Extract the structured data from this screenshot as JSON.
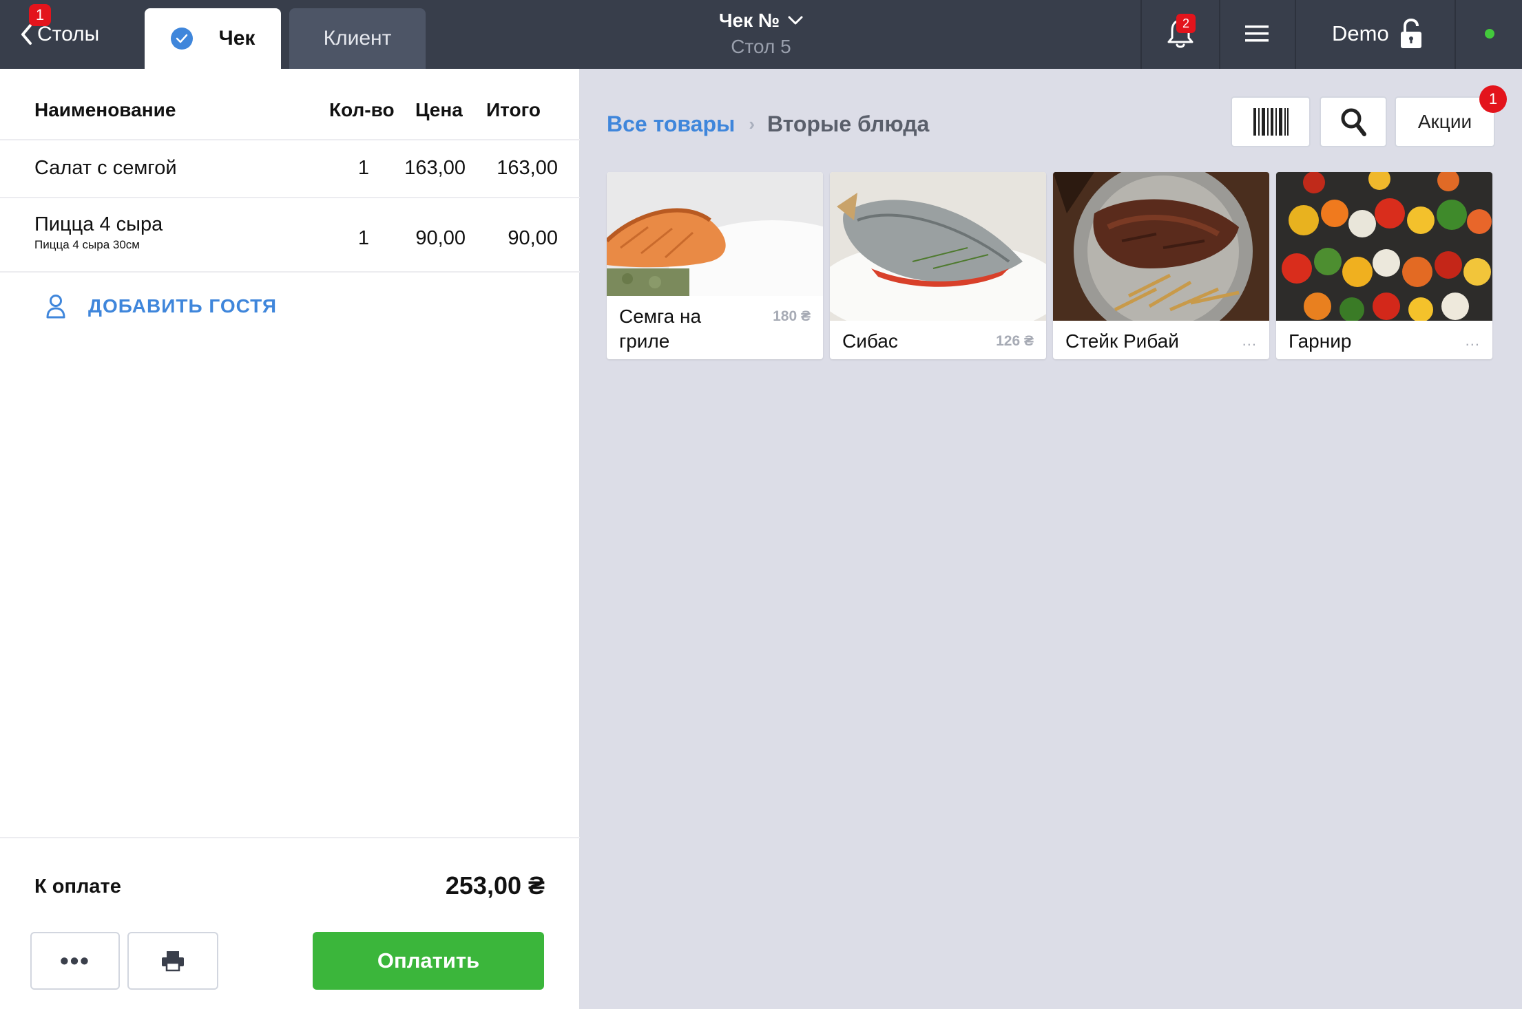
{
  "topbar": {
    "back_label": "Столы",
    "back_badge": "1",
    "tabs": [
      {
        "label": "Чек",
        "active": true
      },
      {
        "label": "Клиент",
        "active": false
      }
    ],
    "order_title": "Чек №",
    "table_label": "Стол 5",
    "notifications_badge": "2",
    "user_name": "Demo",
    "status_color": "#43c93c"
  },
  "order": {
    "columns": {
      "name": "Наименование",
      "qty": "Кол-во",
      "price": "Цена",
      "total": "Итого"
    },
    "items": [
      {
        "name": "Салат с семгой",
        "sub": "",
        "qty": "1",
        "price": "163,00",
        "total": "163,00"
      },
      {
        "name": "Пицца 4 сыра",
        "sub": "Пицца 4 сыра 30см",
        "qty": "1",
        "price": "90,00",
        "total": "90,00"
      }
    ],
    "add_guest_label": "ДОБАВИТЬ ГОСТЯ",
    "to_pay_label": "К оплате",
    "to_pay_value": "253,00 ₴",
    "more_label": "•••",
    "pay_label": "Оплатить"
  },
  "catalog": {
    "breadcrumb_root": "Все товары",
    "breadcrumb_sep": "›",
    "breadcrumb_current": "Вторые блюда",
    "promo_label": "Акции",
    "promo_badge": "1",
    "products": [
      {
        "name_line1": "Семга на",
        "name_line2": "гриле",
        "price": "180 ₴"
      },
      {
        "name_line1": "Сибас",
        "name_line2": "",
        "price": "126 ₴"
      },
      {
        "name_line1": "Стейк Рибай",
        "name_line2": "",
        "price": "..."
      },
      {
        "name_line1": "Гарнир",
        "name_line2": "",
        "price": "..."
      }
    ]
  },
  "colors": {
    "accent_blue": "#3f86db",
    "pay_green": "#3bb63b",
    "badge_red": "#e3141c",
    "topbar_bg": "#383e4b"
  }
}
